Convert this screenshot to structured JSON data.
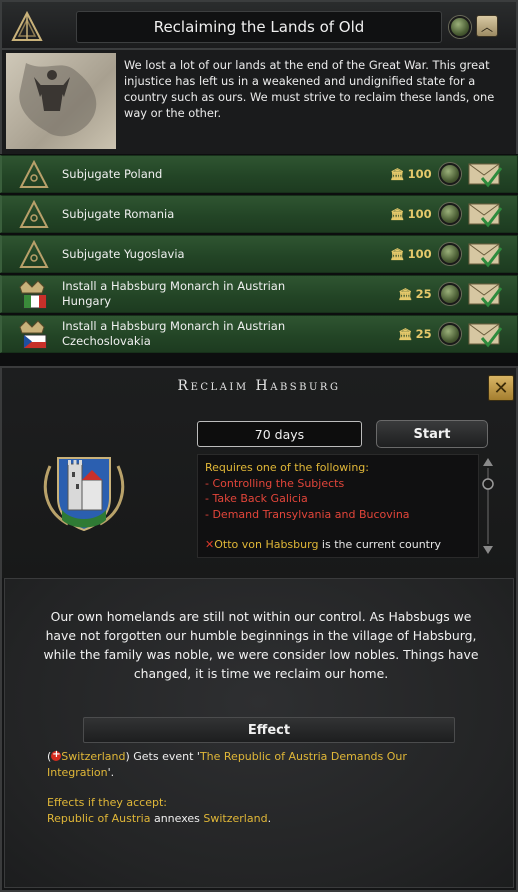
{
  "focus_tree": {
    "title": "Reclaiming the Lands of Old",
    "description": "We lost a lot of our lands at the end of the Great War. This great injustice has left us in a weakened and undignified state for a country such as ours. We must strive to reclaim these lands, one way or the other.",
    "items": [
      {
        "label": "Subjugate Poland",
        "cost": "100",
        "icon": "military-compass-icon"
      },
      {
        "label": "Subjugate Romania",
        "cost": "100",
        "icon": "military-compass-icon"
      },
      {
        "label": "Subjugate Yugoslavia",
        "cost": "100",
        "icon": "military-compass-icon"
      },
      {
        "label": "Install a Habsburg Monarch in Austrian Hungary",
        "cost": "25",
        "icon": "crown-flag-icon"
      },
      {
        "label": "Install a Habsburg Monarch in Austrian Czechoslovakia",
        "cost": "25",
        "icon": "crown-flag-icon"
      }
    ]
  },
  "decision": {
    "title": "Reclaim Habsburg",
    "duration": "70 days",
    "start_label": "Start",
    "requirements": {
      "heading": "Requires one of the following:",
      "items": [
        "- Controlling the Subjects",
        "- Take Back Galicia",
        "- Demand Transylvania and Bucovina"
      ],
      "footer_name": "Otto von Habsburg",
      "footer_rest": " is the current country"
    },
    "story": "Our own homelands are still not within our control. As Habsbugs we have not forgotten our humble beginnings in the village of Habsburg, while the family was noble, we were consider low nobles. Things have changed, it is time we reclaim our home.",
    "effect_label": "Effect",
    "effects": {
      "open_paren": "(",
      "country": "Switzerland",
      "line1_mid": ") Gets event '",
      "event": "The Republic of Austria Demands Our Integration",
      "line1_end": "'.",
      "accept_heading": "Effects if they accept:",
      "actor": "Republic of Austria",
      "verb": " annexes ",
      "target": "Switzerland",
      "end": "."
    }
  },
  "colors": {
    "accent_gold": "#e0b738",
    "requirement_red": "#e2453a",
    "row_green": "#2f5531"
  }
}
